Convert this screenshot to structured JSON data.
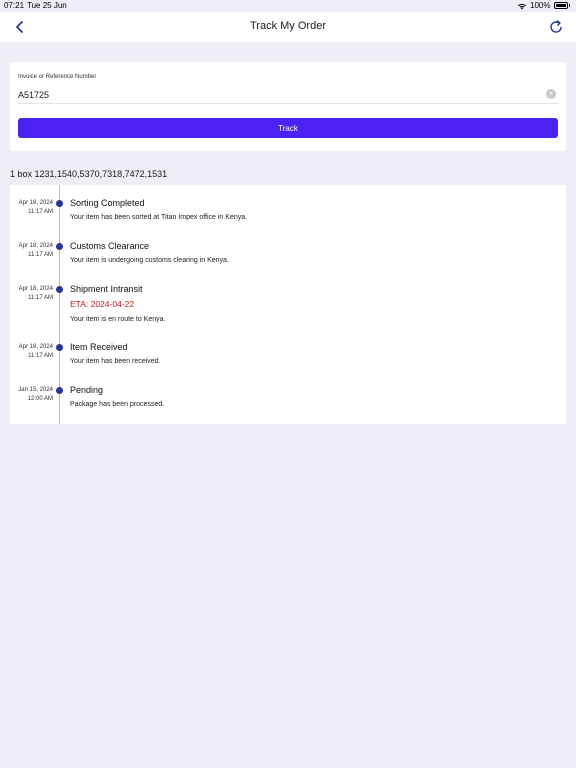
{
  "status_bar": {
    "time": "07:21",
    "date": "Tue 25 Jun",
    "battery": "100%"
  },
  "nav": {
    "title": "Track My Order"
  },
  "search": {
    "label": "Invoice or Reference Number",
    "value": "A51725",
    "button_label": "Track"
  },
  "summary": "1 box 1231,1540,5370,7318,7472,1531",
  "events": [
    {
      "date": "Apr 18, 2024",
      "time": "11:17 AM",
      "title": "Sorting Completed",
      "eta": "",
      "description": "Your item has been sorted at Titan Impex office in Kenya."
    },
    {
      "date": "Apr 18, 2024",
      "time": "11:17 AM",
      "title": "Customs Clearance",
      "eta": "",
      "description": "Your item is undergoing customs clearing in Kenya."
    },
    {
      "date": "Apr 18, 2024",
      "time": "11:17 AM",
      "title": "Shipment Intransit",
      "eta": "ETA: 2024-04-22",
      "description": "Your item is en route to Kenya."
    },
    {
      "date": "Apr 18, 2024",
      "time": "11:17 AM",
      "title": "Item Received",
      "eta": "",
      "description": "Your item has been received."
    },
    {
      "date": "Jan 15, 2024",
      "time": "12:00 AM",
      "title": "Pending",
      "eta": "",
      "description": "Package has been processed."
    }
  ],
  "colors": {
    "accent": "#4b22f3",
    "timeline_dot": "#283593",
    "eta": "#b71c1c",
    "background": "#eeeef6"
  }
}
